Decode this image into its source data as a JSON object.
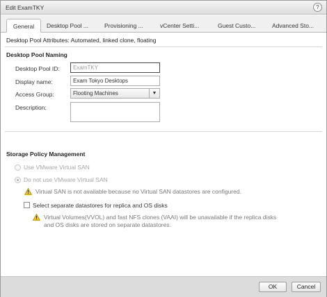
{
  "window": {
    "title": "Edit ExamTKY",
    "help_glyph": "?"
  },
  "tabs": [
    {
      "label": "General",
      "active": true
    },
    {
      "label": "Desktop Pool ...",
      "active": false
    },
    {
      "label": "Provisioning ...",
      "active": false
    },
    {
      "label": "vCenter Setti...",
      "active": false
    },
    {
      "label": "Guest Custo...",
      "active": false
    },
    {
      "label": "Advanced Sto...",
      "active": false
    }
  ],
  "attributes_line": "Desktop Pool Attributes: Automated, linked clone, floating",
  "naming": {
    "section_title": "Desktop Pool Naming",
    "pool_id_label": "Desktop Pool ID:",
    "pool_id_value": "ExamTKY",
    "display_name_label": "Display name:",
    "display_name_value": "Exam Tokyo Desktops",
    "access_group_label": "Access Group:",
    "access_group_value": "Flooting Machines",
    "access_group_arrow": "▼",
    "description_label": "Description:",
    "description_value": ""
  },
  "storage": {
    "section_title": "Storage Policy Management",
    "option_use_vsan": "Use VMware Virtual SAN",
    "option_no_vsan": "Do not use VMware Virtual SAN",
    "vsan_warning": "Virtual SAN is not available because no Virtual SAN datastores are configured.",
    "separate_ds_label": "Select separate datastores for replica and OS disks",
    "vvol_warning_line1": "Virtual Volumes(VVOL) and fast NFS clones (VAAI) will be unavailable if the replica disks",
    "vvol_warning_line2": "and OS disks are stored on separate datastores."
  },
  "footer": {
    "ok_label": "OK",
    "cancel_label": "Cancel"
  },
  "colors": {
    "warning_icon": "#f2c21a",
    "footer_bg": "#dcdcdc",
    "titlebar_bg": "#e8e8e8"
  },
  "icons": {
    "warning": "warning-icon",
    "help": "help-icon",
    "dropdown": "chevron-down-icon"
  }
}
